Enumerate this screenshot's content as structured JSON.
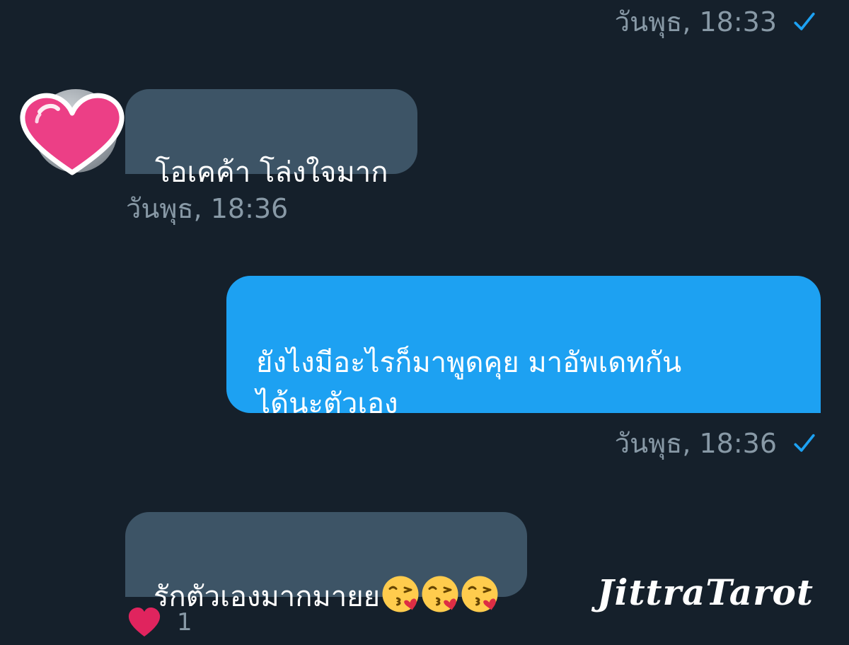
{
  "messages": [
    {
      "direction": "out",
      "timestamp": "วันพุธ, 18:33",
      "read": true
    },
    {
      "direction": "in",
      "text": "โอเคค้า โล่งใจมาก",
      "timestamp": "วันพุธ, 18:36"
    },
    {
      "direction": "out",
      "text": "ยังไงมีอะไรก็มาพูดคุย มาอัพเดทกัน\nได้นะตัวเอง",
      "timestamp": "วันพุธ, 18:36",
      "read": true
    },
    {
      "direction": "in",
      "text": "รักตัวเองมากมายย",
      "emojis": [
        "kissing-heart-emoji",
        "kissing-heart-emoji",
        "kissing-heart-emoji"
      ],
      "reaction": {
        "icon": "heart-icon",
        "count": "1"
      }
    }
  ],
  "watermark": "JittraTarot",
  "colors": {
    "background": "#15202b",
    "incoming_bubble": "#3d5466",
    "outgoing_bubble": "#1da1f2",
    "timestamp": "#8899a6",
    "check": "#1da1f2",
    "reaction_heart": "#e0245e"
  }
}
